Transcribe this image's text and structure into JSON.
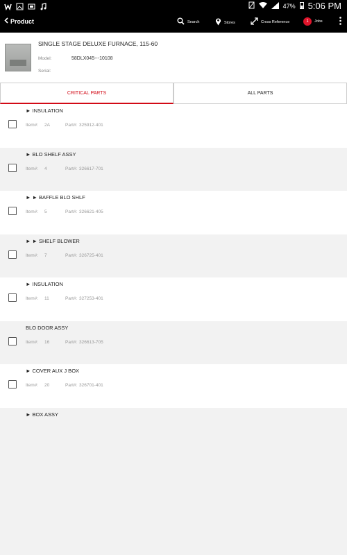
{
  "statusbar": {
    "left_icons": [
      "w-icon",
      "image-icon",
      "gallery-icon",
      "music-icon"
    ],
    "battery": "47%",
    "time": "5:06 PM"
  },
  "toolbar": {
    "back_label": "Product",
    "search_label": "Search",
    "stores_label": "Stores",
    "cross_label": "Cross Reference",
    "jobs_count": "1",
    "jobs_label": "Jobs"
  },
  "product": {
    "name": "SINGLE STAGE DELUXE FURNACE, 115-60",
    "model_label": "Model:",
    "model_value": "58DLX045---10108",
    "serial_label": "Serial:"
  },
  "tabs": {
    "critical": "CRITICAL PARTS",
    "all": "ALL PARTS"
  },
  "labels": {
    "item": "Item#:",
    "part": "Part#:"
  },
  "parts": [
    {
      "title": "► INSULATION",
      "item": "2A",
      "part": "325912-401"
    },
    {
      "title": "► BLO SHELF ASSY",
      "item": "4",
      "part": "326617-701"
    },
    {
      "title": "► ► BAFFLE BLO SHLF",
      "item": "5",
      "part": "326621-405"
    },
    {
      "title": "► ► SHELF BLOWER",
      "item": "7",
      "part": "326725-401"
    },
    {
      "title": "► INSULATION",
      "item": "11",
      "part": "327253-401"
    },
    {
      "title": "BLO DOOR ASSY",
      "item": "16",
      "part": "326613-705"
    },
    {
      "title": "► COVER AUX J BOX",
      "item": "20",
      "part": "326701-401"
    },
    {
      "title": "► BOX ASSY",
      "item": "",
      "part": ""
    }
  ]
}
